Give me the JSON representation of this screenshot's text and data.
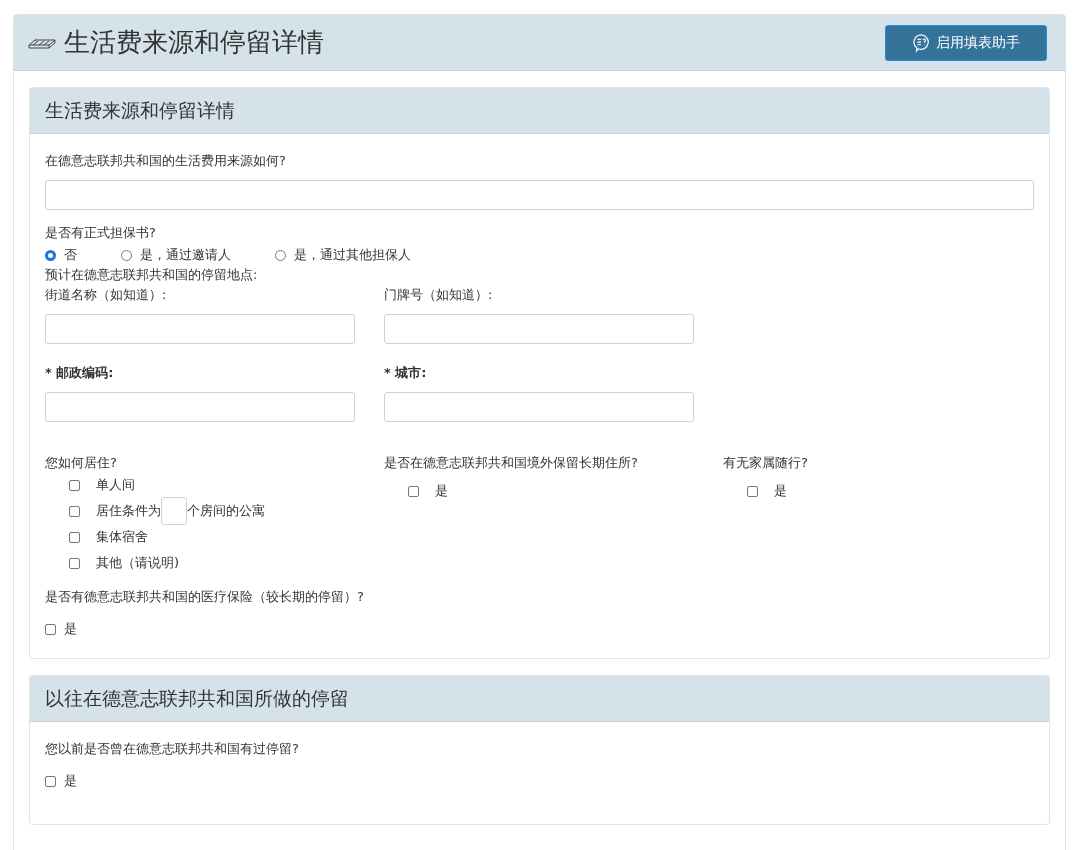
{
  "page": {
    "title": "生活费来源和停留详情",
    "assistant_button": "启用填表助手"
  },
  "sections": [
    {
      "title": "生活费来源和停留详情",
      "kind": "stay",
      "funding": {
        "label": "在德意志联邦共和国的生活费用来源如何?"
      },
      "guarantee": {
        "label": "是否有正式担保书?",
        "options": [
          {
            "label": "否",
            "selected": true
          },
          {
            "label": "是，通过邀请人",
            "selected": false
          },
          {
            "label": "是，通过其他担保人",
            "selected": false
          }
        ]
      },
      "place_label": "预计在德意志联邦共和国的停留地点:",
      "address_fields": [
        {
          "label": "街道名称（如知道）:",
          "required": false
        },
        {
          "label": "门牌号（如知道）:",
          "required": false
        },
        {
          "label": "* 邮政编码:",
          "required": true
        },
        {
          "label": "* 城市:",
          "required": true
        }
      ],
      "housing": {
        "label": "您如何居住?",
        "options": [
          {
            "kind": "plain",
            "label": "单人间",
            "checked": false
          },
          {
            "kind": "rooms",
            "label": "居住条件为",
            "suffix": "个房间的公寓",
            "checked": false
          },
          {
            "kind": "plain",
            "label": "集体宿舍",
            "checked": false
          },
          {
            "kind": "plain",
            "label": "其他（请说明)",
            "checked": false
          }
        ]
      },
      "residence": {
        "label": "是否在德意志联邦共和国境外保留长期住所?",
        "option": "是",
        "checked": false
      },
      "family": {
        "label": "有无家属随行?",
        "option": "是",
        "checked": false
      },
      "insurance": {
        "label": "是否有德意志联邦共和国的医疗保险（较长期的停留）?",
        "option": "是",
        "checked": false
      }
    },
    {
      "title": "以往在德意志联邦共和国所做的停留",
      "kind": "previous",
      "question": {
        "label": "您以前是否曾在德意志联邦共和国有过停留?",
        "option": "是",
        "checked": false
      }
    }
  ]
}
